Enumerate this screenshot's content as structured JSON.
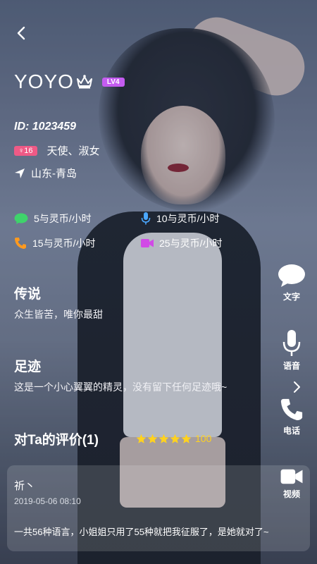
{
  "profile": {
    "name": "YOYO",
    "level": "LV4",
    "id_text": "ID: 1023459",
    "gender_age": "♀16",
    "tags": "天使、淑女",
    "location": "山东-青岛"
  },
  "prices": {
    "text": "5与灵币/小时",
    "voice": "10与灵币/小时",
    "phone": "15与灵币/小时",
    "video": "25与灵币/小时"
  },
  "legend": {
    "title": "传说",
    "text": "众生皆苦，唯你最甜"
  },
  "footprint": {
    "title": "足迹",
    "text": "这是一个小心翼翼的精灵，没有留下任何足迹哦~"
  },
  "rating": {
    "title": "对Ta的评价(1)",
    "stars": 5,
    "score": "100"
  },
  "side_actions": {
    "text_label": "文字",
    "voice_label": "语音",
    "phone_label": "电话",
    "video_label": "视频"
  },
  "review": {
    "author": "祈丶",
    "time": "2019-05-06 08:10",
    "content": "一共56种语言，小姐姐只用了55种就把我征服了，是她就对了~"
  },
  "colors": {
    "level_badge": "#c45cf0",
    "gender_badge": "#ef5a86",
    "text_icon": "#3fd36b",
    "voice_icon": "#4aa7ff",
    "phone_icon": "#ff9a1f",
    "video_icon": "#d14ae6",
    "star": "#ffd21f"
  }
}
